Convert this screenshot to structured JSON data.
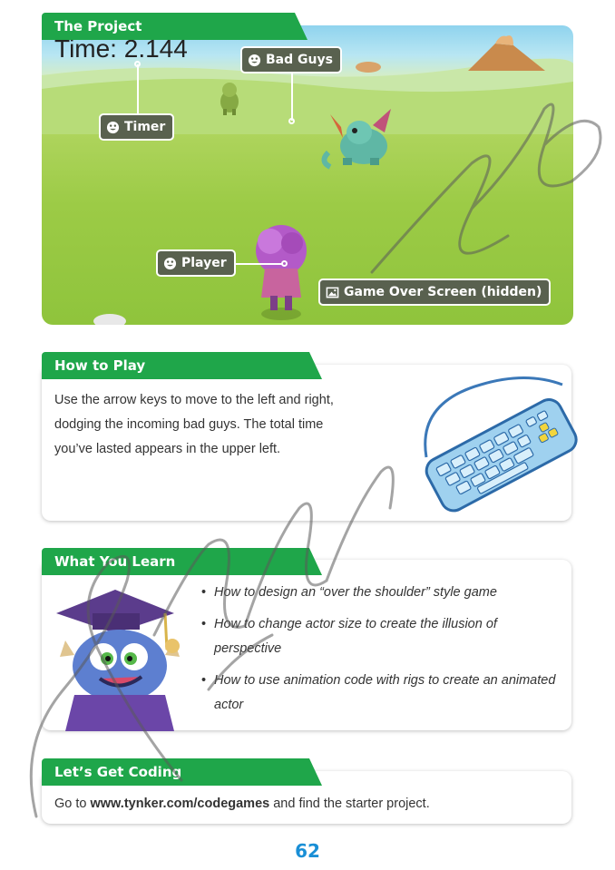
{
  "project": {
    "tab_label": "The Project",
    "timer_readout": "Time: 2.144",
    "callouts": {
      "bad_guys": "Bad Guys",
      "timer": "Timer",
      "player": "Player",
      "game_over": "Game Over Screen (hidden)"
    }
  },
  "how_to_play": {
    "tab_label": "How to Play",
    "lines": [
      "Use the arrow keys to move to the left and right,",
      "dodging the incoming bad guys. The total time",
      "you’ve lasted appears in the upper left."
    ]
  },
  "what_you_learn": {
    "tab_label": "What You Learn",
    "items": [
      "How to design an “over the shoulder” style game",
      "How to change actor size to create the illusion of perspective",
      "How to use animation code with rigs to create an animated actor"
    ]
  },
  "lets_get_coding": {
    "tab_label": "Let’s Get Coding",
    "text_before": "Go to ",
    "link": "www.tynker.com/codegames",
    "text_after": " and find the starter project."
  },
  "page_number": "62",
  "colors": {
    "tab_green": "#1fa64a",
    "callout_bg": "#59614f",
    "page_number_blue": "#1a8fd6"
  }
}
